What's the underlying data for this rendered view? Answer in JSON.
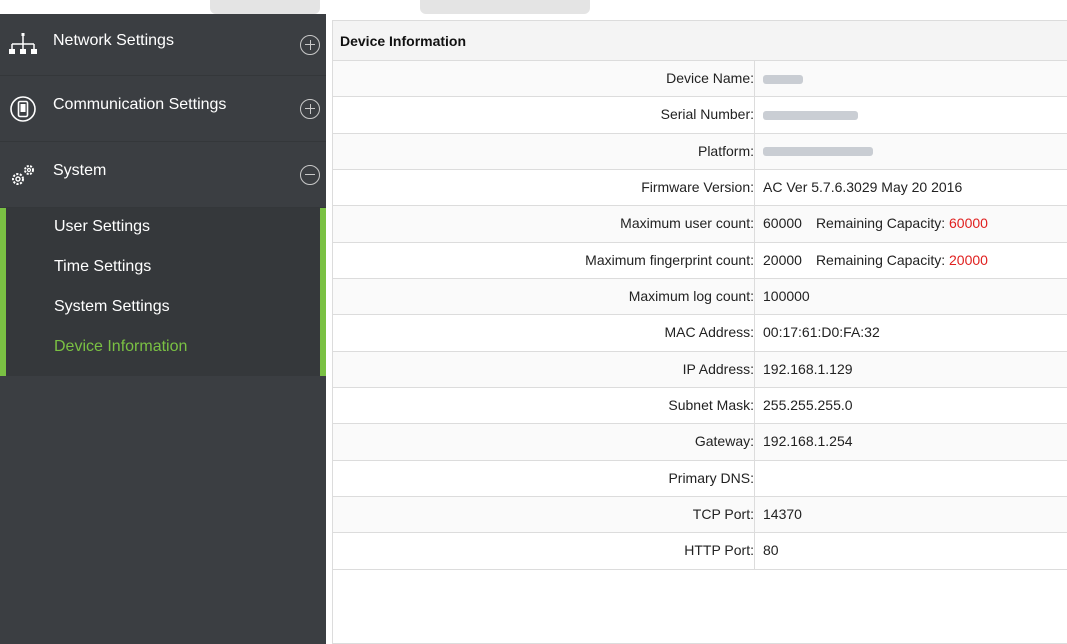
{
  "sidebar": {
    "groups": [
      {
        "label": "Network Settings",
        "icon": "network-icon",
        "toggle": "plus-circle-icon"
      },
      {
        "label": "Communication Settings",
        "icon": "communication-icon",
        "toggle": "plus-circle-icon"
      },
      {
        "label": "System",
        "icon": "gears-icon",
        "toggle": "minus-circle-icon"
      }
    ],
    "subitems": [
      {
        "label": "User Settings"
      },
      {
        "label": "Time Settings"
      },
      {
        "label": "System Settings"
      },
      {
        "label": "Device Information",
        "active": true
      }
    ],
    "accent_color": "#7ac143",
    "background_color": "#3b3e42"
  },
  "main": {
    "title": "Device Information",
    "rows": [
      {
        "label": "Device Name:",
        "value": ""
      },
      {
        "label": "Serial Number:",
        "value": ""
      },
      {
        "label": "Platform:",
        "value": ""
      },
      {
        "label": "Firmware Version:",
        "value": "AC Ver 5.7.6.3029 May 20 2016"
      },
      {
        "label": "Maximum user count:",
        "value": "60000",
        "remaining_label": "Remaining Capacity:",
        "remaining_value": "60000"
      },
      {
        "label": "Maximum fingerprint count:",
        "value": "20000",
        "remaining_label": "Remaining Capacity:",
        "remaining_value": "20000"
      },
      {
        "label": "Maximum log count:",
        "value": "100000"
      },
      {
        "label": "MAC Address:",
        "value": "00:17:61:D0:FA:32"
      },
      {
        "label": "IP Address:",
        "value": "192.168.1.129"
      },
      {
        "label": "Subnet Mask:",
        "value": "255.255.255.0"
      },
      {
        "label": "Gateway:",
        "value": "192.168.1.254"
      },
      {
        "label": "Primary DNS:",
        "value": ""
      },
      {
        "label": "TCP Port:",
        "value": "14370"
      },
      {
        "label": "HTTP Port:",
        "value": "80"
      }
    ],
    "highlight_color": "#e0201f"
  }
}
